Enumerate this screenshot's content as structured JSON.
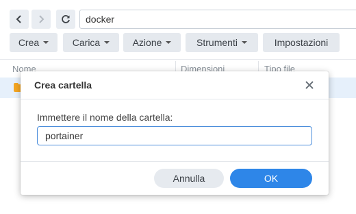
{
  "navigation": {
    "back_icon": "chevron-left-icon",
    "forward_icon": "chevron-right-icon",
    "refresh_icon": "refresh-icon",
    "path": "docker"
  },
  "toolbar": {
    "create": "Crea",
    "upload": "Carica",
    "action": "Azione",
    "tools": "Strumenti",
    "settings": "Impostazioni"
  },
  "file_list": {
    "columns": [
      "Nome",
      "Dimensioni",
      "Tipo file"
    ],
    "folder_icon": "folder-icon"
  },
  "dialog": {
    "title": "Crea cartella",
    "close_icon": "close-icon",
    "label": "Immettere il nome della cartella:",
    "input_value": "portainer",
    "cancel_label": "Annulla",
    "ok_label": "OK"
  },
  "colors": {
    "accent": "#2e86e8",
    "selected_row": "#e6f0fb",
    "folder": "#f5a623"
  }
}
